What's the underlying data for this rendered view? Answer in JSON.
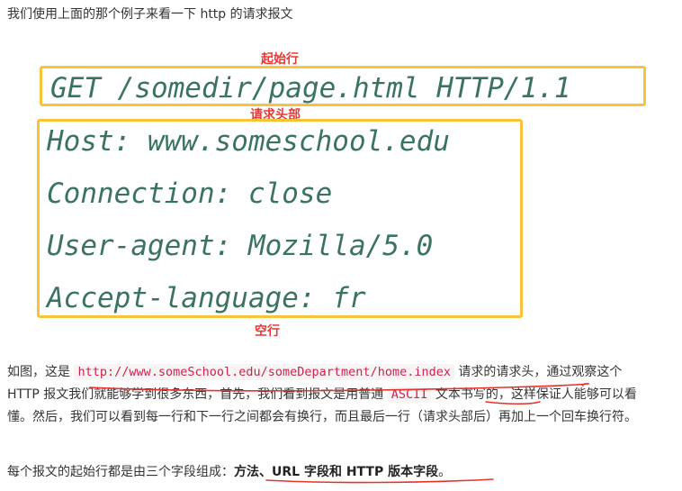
{
  "intro": "我们使用上面的那个例子来看一下 http 的请求报文",
  "labels": {
    "start_line": "起始行",
    "headers": "请求头部",
    "blank_line": "空行"
  },
  "request": {
    "start_line": "GET /somedir/page.html HTTP/1.1",
    "headers": [
      "Host: www.someschool.edu",
      "Connection: close",
      "User-agent: Mozilla/5.0",
      "Accept-language: fr"
    ]
  },
  "paragraph1": {
    "prefix": "如图，这是 ",
    "url": "http://www.someSchool.edu/someDepartment/home.index",
    "mid1": " 请求的请求头，通过观察这个 HTTP 报文我们就能够学到很多东西，首先，我们看到报文是用普通 ",
    "ascii": "ASCII",
    "mid2": " 文本书写的，这样保证人能够可以看懂。然后，我们可以看到每一行和下一行之间都会有换行，而且最后一行（请求头部后）再加上一个回车换行符。"
  },
  "paragraph2": {
    "prefix": "每个报文的起始行都是由三个字段组成：",
    "bold": "方法、URL 字段和 HTTP 版本字段",
    "suffix": "。"
  },
  "colors": {
    "annotation_red": "#e53935",
    "highlight_box": "#f7c338",
    "code_text": "#3a7363"
  }
}
